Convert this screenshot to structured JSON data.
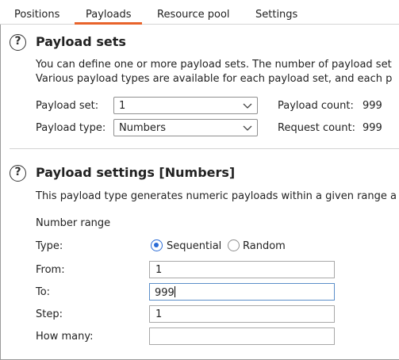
{
  "tabs": [
    {
      "label": "Positions"
    },
    {
      "label": "Payloads"
    },
    {
      "label": "Resource pool"
    },
    {
      "label": "Settings"
    }
  ],
  "active_tab": "Payloads",
  "payload_sets": {
    "title": "Payload sets",
    "desc_line1": "You can define one or more payload sets. The number of payload set",
    "desc_line2": "Various payload types are available for each payload set, and each p",
    "payload_set_label": "Payload set:",
    "payload_set_value": "1",
    "payload_type_label": "Payload type:",
    "payload_type_value": "Numbers",
    "payload_count_label": "Payload count:",
    "payload_count_value": "999",
    "request_count_label": "Request count:",
    "request_count_value": "999"
  },
  "payload_settings": {
    "title": "Payload settings [Numbers]",
    "desc": "This payload type generates numeric payloads within a given range a",
    "number_range_label": "Number range",
    "type_label": "Type:",
    "type_options": [
      {
        "label": "Sequential",
        "selected": true
      },
      {
        "label": "Random",
        "selected": false
      }
    ],
    "from_label": "From:",
    "from_value": "1",
    "to_label": "To:",
    "to_value": "999",
    "step_label": "Step:",
    "step_value": "1",
    "how_many_label": "How many:",
    "how_many_value": ""
  },
  "colors": {
    "accent": "#e8632a",
    "radio_selected": "#2a6bd6",
    "focus_border": "#5b8ec9"
  },
  "icons": {
    "help": "question-circle-icon",
    "dropdown": "chevron-down-icon"
  }
}
